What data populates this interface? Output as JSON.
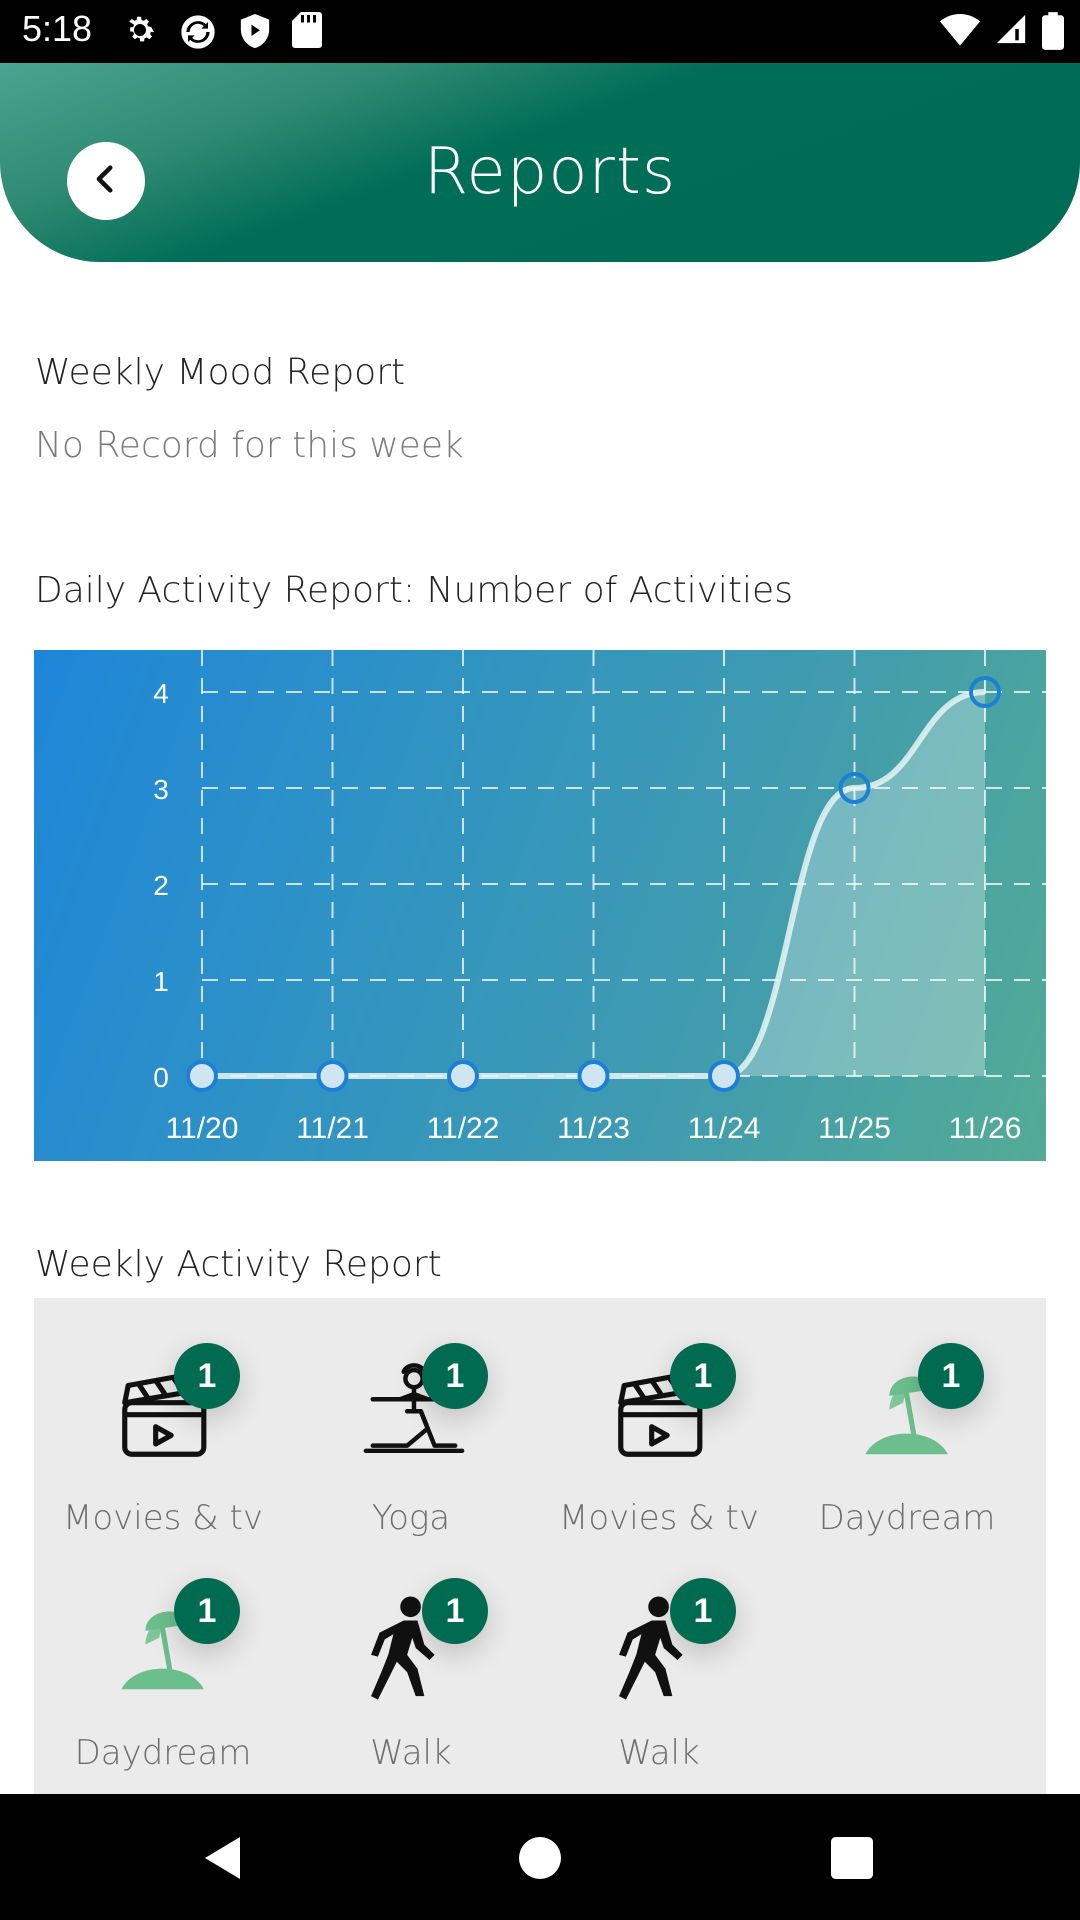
{
  "status_bar": {
    "time": "5:18"
  },
  "header": {
    "title": "Reports"
  },
  "mood_report": {
    "title": "Weekly Mood Report",
    "empty_text": "No Record for this week"
  },
  "activity_chart": {
    "title": "Daily Activity Report: Number of Activities"
  },
  "chart_data": {
    "type": "area",
    "categories": [
      "11/20",
      "11/21",
      "11/22",
      "11/23",
      "11/24",
      "11/25",
      "11/26"
    ],
    "values": [
      0,
      0,
      0,
      0,
      0,
      3,
      4
    ],
    "y_ticks": [
      "0",
      "1",
      "2",
      "3",
      "4"
    ],
    "ylim": [
      0,
      4
    ],
    "grid": true,
    "line_color": "#e3f3f3",
    "marker_color": "#1e7fd6"
  },
  "weekly_activity": {
    "title": "Weekly Activity Report",
    "items": [
      {
        "label": "Movies & tv",
        "count": "1",
        "icon": "clapperboard-icon"
      },
      {
        "label": "Yoga",
        "count": "1",
        "icon": "yoga-icon"
      },
      {
        "label": "Movies & tv",
        "count": "1",
        "icon": "clapperboard-icon"
      },
      {
        "label": "Daydream",
        "count": "1",
        "icon": "beach-umbrella-icon"
      },
      {
        "label": "Daydream",
        "count": "1",
        "icon": "beach-umbrella-icon"
      },
      {
        "label": "Walk",
        "count": "1",
        "icon": "walking-person-icon"
      },
      {
        "label": "Walk",
        "count": "1",
        "icon": "walking-person-icon"
      }
    ]
  },
  "colors": {
    "header_dark": "#006c56",
    "header_light": "#4aa491",
    "badge": "#016b52",
    "umbrella": "#6cbf8d"
  }
}
